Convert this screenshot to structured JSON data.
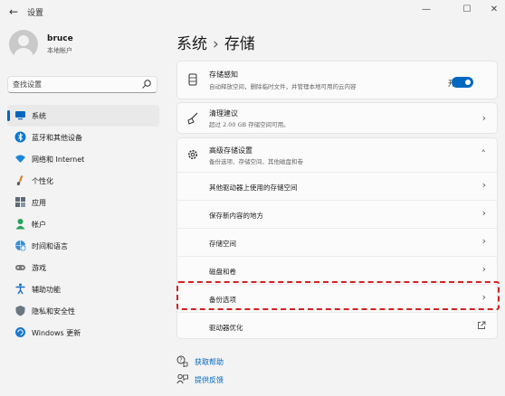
{
  "window": {
    "title": "设置",
    "back_glyph": "←",
    "minimize_glyph": "—",
    "maximize_glyph": "☐",
    "close_glyph": "✕"
  },
  "profile": {
    "name": "bruce",
    "account_type": "本地帐户"
  },
  "search": {
    "placeholder": "查找设置",
    "icon": "search-icon"
  },
  "sidebar": {
    "items": [
      {
        "label": "系统",
        "icon": "system-icon",
        "active": true
      },
      {
        "label": "蓝牙和其他设备",
        "icon": "bluetooth-icon"
      },
      {
        "label": "网络和 Internet",
        "icon": "wifi-icon"
      },
      {
        "label": "个性化",
        "icon": "brush-icon"
      },
      {
        "label": "应用",
        "icon": "apps-icon"
      },
      {
        "label": "帐户",
        "icon": "account-icon"
      },
      {
        "label": "时间和语言",
        "icon": "globe-clock-icon"
      },
      {
        "label": "游戏",
        "icon": "gamepad-icon"
      },
      {
        "label": "辅助功能",
        "icon": "accessibility-icon"
      },
      {
        "label": "隐私和安全性",
        "icon": "shield-icon"
      },
      {
        "label": "Windows 更新",
        "icon": "windows-update-icon"
      }
    ]
  },
  "header": {
    "breadcrumb_parent": "系统",
    "separator": "›",
    "page_title": "存储"
  },
  "storage_sense": {
    "title": "存储感知",
    "subtitle": "自动释放空间，删除临时文件，并管理本地可用的云内容",
    "toggle_label": "开",
    "toggle_on": true
  },
  "cleanup": {
    "title": "清理建议",
    "subtitle": "超过 2.00 GB 存储空间可用。",
    "chevron": "›"
  },
  "advanced": {
    "title": "高级存储设置",
    "subtitle": "备份选项、存储空间、其他磁盘和卷",
    "chevron_up": "˄",
    "items": [
      {
        "label": "其他驱动器上使用的存储空间",
        "chevron": "›"
      },
      {
        "label": "保存新内容的地方",
        "chevron": "›"
      },
      {
        "label": "存储空间",
        "chevron": "›"
      },
      {
        "label": "磁盘和卷",
        "chevron": "›"
      },
      {
        "label": "备份选项",
        "chevron": "›",
        "highlighted": true
      },
      {
        "label": "驱动器优化",
        "external": true
      }
    ]
  },
  "links": {
    "help": "获取帮助",
    "feedback": "提供反馈"
  },
  "colors": {
    "accent": "#0067c0",
    "highlight_border": "#d42020"
  }
}
